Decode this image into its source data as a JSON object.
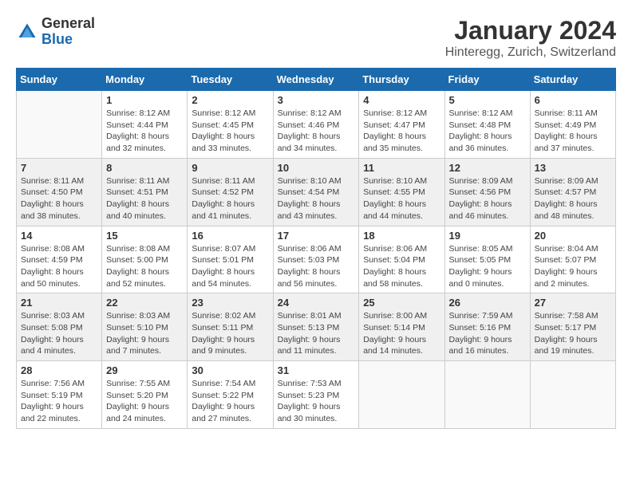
{
  "logo": {
    "general": "General",
    "blue": "Blue"
  },
  "title": "January 2024",
  "subtitle": "Hinteregg, Zurich, Switzerland",
  "days_of_week": [
    "Sunday",
    "Monday",
    "Tuesday",
    "Wednesday",
    "Thursday",
    "Friday",
    "Saturday"
  ],
  "weeks": [
    [
      {
        "day": "",
        "sunrise": "",
        "sunset": "",
        "daylight": ""
      },
      {
        "day": "1",
        "sunrise": "8:12 AM",
        "sunset": "4:44 PM",
        "daylight": "8 hours and 32 minutes."
      },
      {
        "day": "2",
        "sunrise": "8:12 AM",
        "sunset": "4:45 PM",
        "daylight": "8 hours and 33 minutes."
      },
      {
        "day": "3",
        "sunrise": "8:12 AM",
        "sunset": "4:46 PM",
        "daylight": "8 hours and 34 minutes."
      },
      {
        "day": "4",
        "sunrise": "8:12 AM",
        "sunset": "4:47 PM",
        "daylight": "8 hours and 35 minutes."
      },
      {
        "day": "5",
        "sunrise": "8:12 AM",
        "sunset": "4:48 PM",
        "daylight": "8 hours and 36 minutes."
      },
      {
        "day": "6",
        "sunrise": "8:11 AM",
        "sunset": "4:49 PM",
        "daylight": "8 hours and 37 minutes."
      }
    ],
    [
      {
        "day": "7",
        "sunrise": "8:11 AM",
        "sunset": "4:50 PM",
        "daylight": "8 hours and 38 minutes."
      },
      {
        "day": "8",
        "sunrise": "8:11 AM",
        "sunset": "4:51 PM",
        "daylight": "8 hours and 40 minutes."
      },
      {
        "day": "9",
        "sunrise": "8:11 AM",
        "sunset": "4:52 PM",
        "daylight": "8 hours and 41 minutes."
      },
      {
        "day": "10",
        "sunrise": "8:10 AM",
        "sunset": "4:54 PM",
        "daylight": "8 hours and 43 minutes."
      },
      {
        "day": "11",
        "sunrise": "8:10 AM",
        "sunset": "4:55 PM",
        "daylight": "8 hours and 44 minutes."
      },
      {
        "day": "12",
        "sunrise": "8:09 AM",
        "sunset": "4:56 PM",
        "daylight": "8 hours and 46 minutes."
      },
      {
        "day": "13",
        "sunrise": "8:09 AM",
        "sunset": "4:57 PM",
        "daylight": "8 hours and 48 minutes."
      }
    ],
    [
      {
        "day": "14",
        "sunrise": "8:08 AM",
        "sunset": "4:59 PM",
        "daylight": "8 hours and 50 minutes."
      },
      {
        "day": "15",
        "sunrise": "8:08 AM",
        "sunset": "5:00 PM",
        "daylight": "8 hours and 52 minutes."
      },
      {
        "day": "16",
        "sunrise": "8:07 AM",
        "sunset": "5:01 PM",
        "daylight": "8 hours and 54 minutes."
      },
      {
        "day": "17",
        "sunrise": "8:06 AM",
        "sunset": "5:03 PM",
        "daylight": "8 hours and 56 minutes."
      },
      {
        "day": "18",
        "sunrise": "8:06 AM",
        "sunset": "5:04 PM",
        "daylight": "8 hours and 58 minutes."
      },
      {
        "day": "19",
        "sunrise": "8:05 AM",
        "sunset": "5:05 PM",
        "daylight": "9 hours and 0 minutes."
      },
      {
        "day": "20",
        "sunrise": "8:04 AM",
        "sunset": "5:07 PM",
        "daylight": "9 hours and 2 minutes."
      }
    ],
    [
      {
        "day": "21",
        "sunrise": "8:03 AM",
        "sunset": "5:08 PM",
        "daylight": "9 hours and 4 minutes."
      },
      {
        "day": "22",
        "sunrise": "8:03 AM",
        "sunset": "5:10 PM",
        "daylight": "9 hours and 7 minutes."
      },
      {
        "day": "23",
        "sunrise": "8:02 AM",
        "sunset": "5:11 PM",
        "daylight": "9 hours and 9 minutes."
      },
      {
        "day": "24",
        "sunrise": "8:01 AM",
        "sunset": "5:13 PM",
        "daylight": "9 hours and 11 minutes."
      },
      {
        "day": "25",
        "sunrise": "8:00 AM",
        "sunset": "5:14 PM",
        "daylight": "9 hours and 14 minutes."
      },
      {
        "day": "26",
        "sunrise": "7:59 AM",
        "sunset": "5:16 PM",
        "daylight": "9 hours and 16 minutes."
      },
      {
        "day": "27",
        "sunrise": "7:58 AM",
        "sunset": "5:17 PM",
        "daylight": "9 hours and 19 minutes."
      }
    ],
    [
      {
        "day": "28",
        "sunrise": "7:56 AM",
        "sunset": "5:19 PM",
        "daylight": "9 hours and 22 minutes."
      },
      {
        "day": "29",
        "sunrise": "7:55 AM",
        "sunset": "5:20 PM",
        "daylight": "9 hours and 24 minutes."
      },
      {
        "day": "30",
        "sunrise": "7:54 AM",
        "sunset": "5:22 PM",
        "daylight": "9 hours and 27 minutes."
      },
      {
        "day": "31",
        "sunrise": "7:53 AM",
        "sunset": "5:23 PM",
        "daylight": "9 hours and 30 minutes."
      },
      {
        "day": "",
        "sunrise": "",
        "sunset": "",
        "daylight": ""
      },
      {
        "day": "",
        "sunrise": "",
        "sunset": "",
        "daylight": ""
      },
      {
        "day": "",
        "sunrise": "",
        "sunset": "",
        "daylight": ""
      }
    ]
  ]
}
